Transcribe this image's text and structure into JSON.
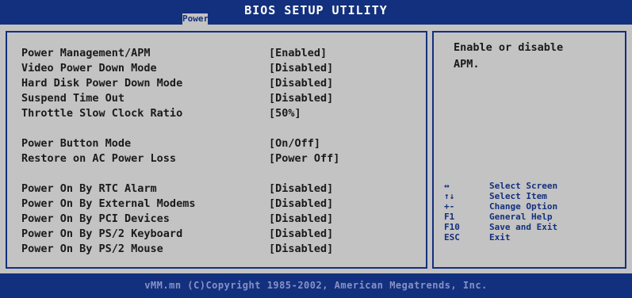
{
  "header": {
    "title": "BIOS SETUP UTILITY",
    "active_tab": "Power"
  },
  "settings": [
    {
      "label": "Power Management/APM",
      "value": "[Enabled]"
    },
    {
      "label": "Video Power Down Mode",
      "value": "[Disabled]"
    },
    {
      "label": "Hard Disk Power Down Mode",
      "value": "[Disabled]"
    },
    {
      "label": "Suspend Time Out",
      "value": "[Disabled]"
    },
    {
      "label": "Throttle Slow Clock Ratio",
      "value": "[50%]"
    },
    {
      "label": "Power Button Mode",
      "value": "[On/Off]"
    },
    {
      "label": "Restore on AC Power Loss",
      "value": "[Power Off]"
    },
    {
      "label": "Power On By RTC Alarm",
      "value": "[Disabled]"
    },
    {
      "label": "Power On By External Modems",
      "value": "[Disabled]"
    },
    {
      "label": "Power On By PCI Devices",
      "value": "[Disabled]"
    },
    {
      "label": "Power On By PS/2 Keyboard",
      "value": "[Disabled]"
    },
    {
      "label": "Power On By PS/2 Mouse",
      "value": "[Disabled]"
    }
  ],
  "help": {
    "line1": "Enable or disable",
    "line2": "APM."
  },
  "keys": [
    {
      "key": "↔",
      "desc": "Select Screen"
    },
    {
      "key": "↑↓",
      "desc": "Select Item"
    },
    {
      "key": "+-",
      "desc": "Change Option"
    },
    {
      "key": "F1",
      "desc": "General Help"
    },
    {
      "key": "F10",
      "desc": "Save and Exit"
    },
    {
      "key": "ESC",
      "desc": "Exit"
    }
  ],
  "footer": {
    "copyright": "vMM.mn (C)Copyright 1985-2002, American Megatrends, Inc."
  },
  "colors": {
    "bar_blue": "#13307e",
    "panel_gray": "#c3c3c3",
    "footer_text": "#8892c4"
  }
}
